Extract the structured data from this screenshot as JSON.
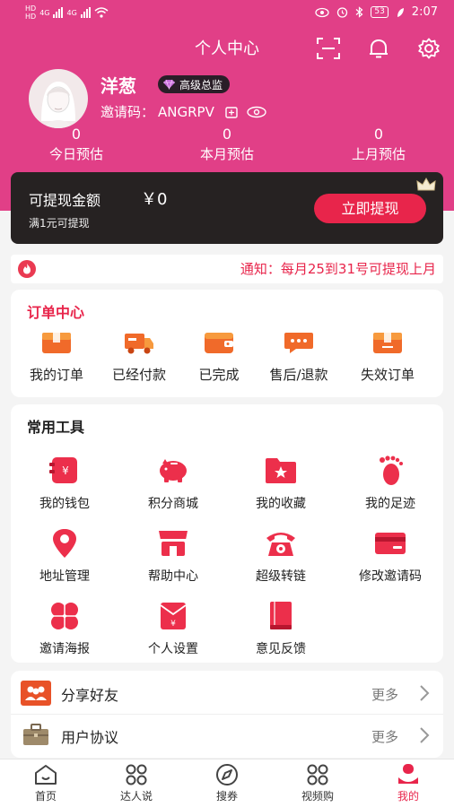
{
  "status_bar": {
    "sim_labels": [
      "HD",
      "HD"
    ],
    "network_1": "4G",
    "network_2": "4G",
    "battery": "53",
    "time": "2:07"
  },
  "header": {
    "title": "个人中心",
    "icons": [
      "scan-icon",
      "bell-icon",
      "gear-icon"
    ]
  },
  "profile": {
    "username": "洋葱",
    "level_badge": "高级总监",
    "invite_label": "邀请码：",
    "invite_code": "ANGRPV"
  },
  "stats": [
    {
      "value": "0",
      "label": "今日预估"
    },
    {
      "value": "0",
      "label": "本月预估"
    },
    {
      "value": "0",
      "label": "上月预估"
    }
  ],
  "withdraw": {
    "label": "可提现金额",
    "amount": "￥0",
    "note": "满1元可提现",
    "button": "立即提现"
  },
  "notice": {
    "text": "通知：每月25到31号可提现上月"
  },
  "orders": {
    "title": "订单中心",
    "items": [
      {
        "label": "我的订单",
        "icon": "order-box-icon"
      },
      {
        "label": "已经付款",
        "icon": "delivery-truck-icon"
      },
      {
        "label": "已完成",
        "icon": "wallet-icon"
      },
      {
        "label": "售后/退款",
        "icon": "chat-bubble-icon"
      },
      {
        "label": "失效订单",
        "icon": "expired-box-icon"
      }
    ]
  },
  "tools": {
    "title": "常用工具",
    "items": [
      {
        "label": "我的钱包",
        "icon": "wallet-yen-icon"
      },
      {
        "label": "积分商城",
        "icon": "piggy-bank-icon"
      },
      {
        "label": "我的收藏",
        "icon": "star-folder-icon"
      },
      {
        "label": "我的足迹",
        "icon": "footprint-icon"
      },
      {
        "label": "地址管理",
        "icon": "location-pin-icon"
      },
      {
        "label": "帮助中心",
        "icon": "shop-icon"
      },
      {
        "label": "超级转链",
        "icon": "telephone-icon"
      },
      {
        "label": "修改邀请码",
        "icon": "card-icon"
      },
      {
        "label": "邀请海报",
        "icon": "clover-icon"
      },
      {
        "label": "个人设置",
        "icon": "red-envelope-icon"
      },
      {
        "label": "意见反馈",
        "icon": "book-icon"
      }
    ]
  },
  "list": [
    {
      "label": "分享好友",
      "more": "更多",
      "icon": "share-friends-icon"
    },
    {
      "label": "用户协议",
      "more": "更多",
      "icon": "briefcase-icon"
    }
  ],
  "bottom_nav": {
    "items": [
      {
        "label": "首页",
        "icon": "home-icon"
      },
      {
        "label": "达人说",
        "icon": "grid-icon"
      },
      {
        "label": "搜券",
        "icon": "compass-icon"
      },
      {
        "label": "视频购",
        "icon": "grid-icon"
      },
      {
        "label": "我的",
        "icon": "profile-icon"
      }
    ],
    "active_index": 4
  },
  "colors": {
    "header_bg": "#e13f87",
    "accent": "#e8254b",
    "withdraw_card": "#262222",
    "order_icon": "#f06a2a"
  }
}
